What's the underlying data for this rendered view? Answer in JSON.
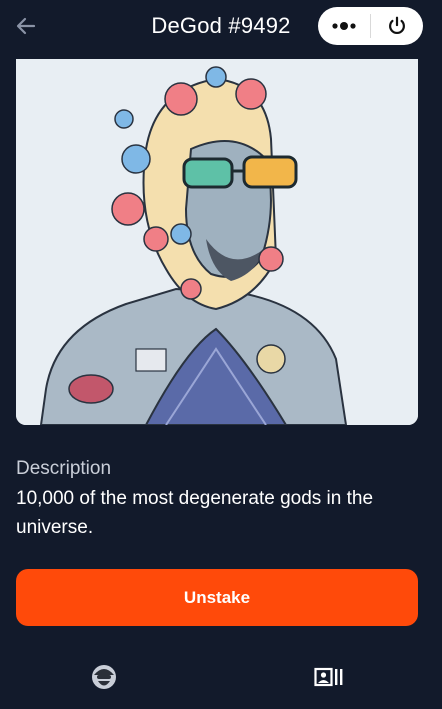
{
  "header": {
    "title": "DeGod #9492",
    "back_icon": "arrow-left-icon",
    "menu_icon": "more-dots-icon",
    "power_icon": "power-icon"
  },
  "nft": {
    "image_icon": "degod-artwork"
  },
  "description": {
    "label": "Description",
    "text": "10,000 of the most degenerate gods in the universe."
  },
  "actions": {
    "unstake_label": "Unstake"
  },
  "tabbar": {
    "items": [
      {
        "icon": "degod-avatar-icon"
      },
      {
        "icon": "gallery-icon"
      }
    ]
  },
  "colors": {
    "background": "#121a2b",
    "accent": "#ff4a0a",
    "card": "#e8eef3"
  }
}
